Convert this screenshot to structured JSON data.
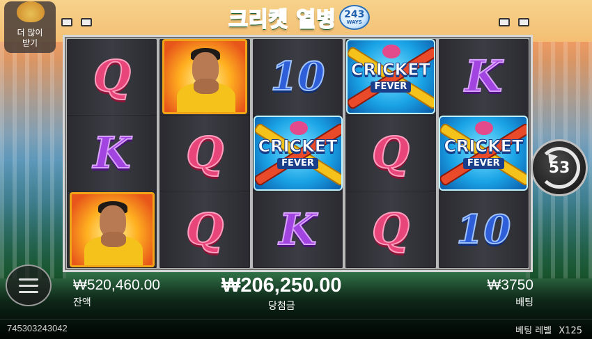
{
  "logo": {
    "title": "크리켓 열병",
    "ways_number": "243",
    "ways_label": "WAYS"
  },
  "buy_more": {
    "line1": "더 많이",
    "line2": "받기"
  },
  "reels": [
    [
      {
        "type": "Q"
      },
      {
        "type": "K"
      },
      {
        "type": "portrait"
      }
    ],
    [
      {
        "type": "portrait"
      },
      {
        "type": "Q"
      },
      {
        "type": "Q"
      }
    ],
    [
      {
        "type": "10"
      },
      {
        "type": "wild"
      },
      {
        "type": "K"
      }
    ],
    [
      {
        "type": "wild"
      },
      {
        "type": "Q"
      },
      {
        "type": "Q"
      }
    ],
    [
      {
        "type": "K"
      },
      {
        "type": "wild"
      },
      {
        "type": "10"
      }
    ]
  ],
  "symbols": {
    "Q": "Q",
    "K": "K",
    "10": "10",
    "wild_line1": "CRICKET",
    "wild_line2": "FEVER",
    "portrait_icon": "batsman-portrait"
  },
  "autospin": {
    "count": "53"
  },
  "balance": {
    "value": "₩520,460.00",
    "label": "잔액"
  },
  "win": {
    "value": "₩206,250.00",
    "label": "당첨금"
  },
  "bet": {
    "value": "₩3750",
    "label": "배팅"
  },
  "footer": {
    "round_id": "745303243042",
    "bet_level_label": "베팅 레벨",
    "bet_level_value": "X125"
  },
  "colors": {
    "reel_bg": "#2f2f36",
    "frame": "#d7d7d7",
    "q": "#e8457a",
    "k": "#a244e0",
    "ten": "#2e5ed8",
    "portrait_border": "#f2a418"
  }
}
